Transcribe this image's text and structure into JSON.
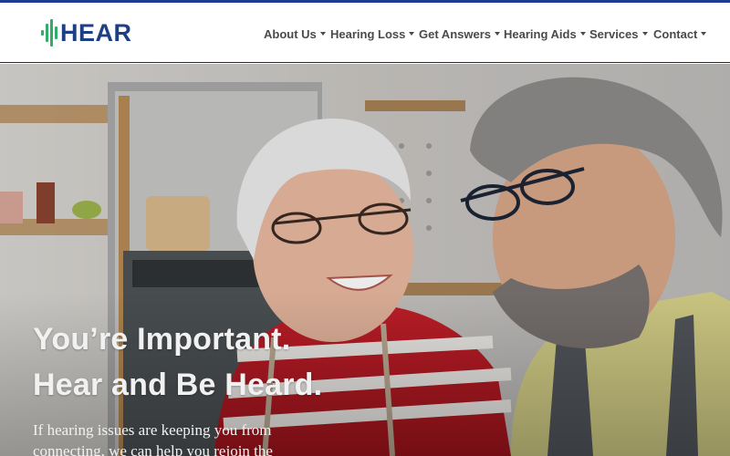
{
  "brand": {
    "logo_text": "HEAR",
    "accent": "#1d3f86",
    "mark_color": "#2fae6a"
  },
  "nav": {
    "items": [
      {
        "label": "About Us"
      },
      {
        "label": "Hearing Loss"
      },
      {
        "label": "Get Answers"
      },
      {
        "label": "Hearing Aids"
      },
      {
        "label": "Services"
      },
      {
        "label": "Contact"
      }
    ]
  },
  "hero": {
    "title_line1": "You’re Important.",
    "title_line2": "Hear and Be Heard.",
    "subtitle": "If hearing issues are keeping you from connecting, we can help you rejoin the"
  }
}
